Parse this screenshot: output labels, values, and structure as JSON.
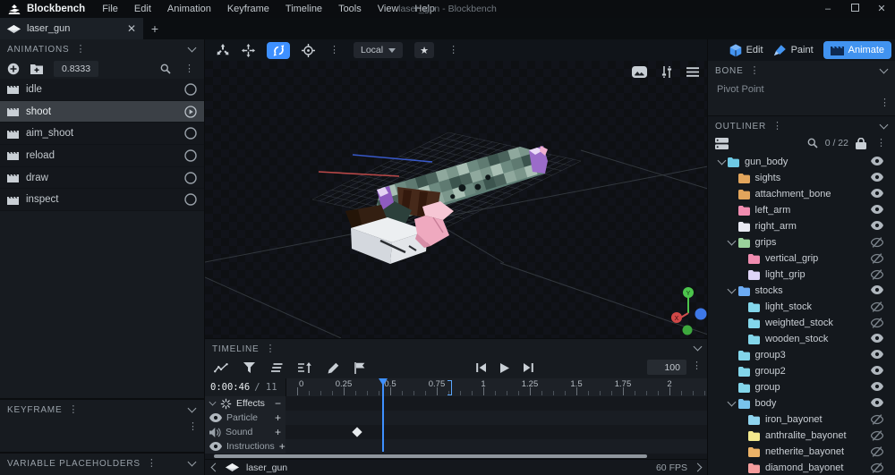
{
  "menubar": {
    "brand": "Blockbench",
    "items": [
      "File",
      "Edit",
      "Animation",
      "Keyframe",
      "Timeline",
      "Tools",
      "View",
      "Help"
    ],
    "window_title": "laser_gun - Blockbench"
  },
  "tab": {
    "title": "laser_gun"
  },
  "tool_toolbar": {
    "space_label": "Local"
  },
  "modes": {
    "edit": "Edit",
    "paint": "Paint",
    "animate": "Animate"
  },
  "animations_panel": {
    "title": "ANIMATIONS",
    "length_value": "0.8333",
    "items": [
      {
        "name": "idle",
        "selected": false
      },
      {
        "name": "shoot",
        "selected": true
      },
      {
        "name": "aim_shoot",
        "selected": false
      },
      {
        "name": "reload",
        "selected": false
      },
      {
        "name": "draw",
        "selected": false
      },
      {
        "name": "inspect",
        "selected": false
      }
    ]
  },
  "keyframe_panel": {
    "title": "KEYFRAME"
  },
  "variable_placeholders_panel": {
    "title": "VARIABLE PLACEHOLDERS"
  },
  "bone_panel": {
    "title": "BONE",
    "field_label": "Pivot Point"
  },
  "outliner": {
    "title": "OUTLINER",
    "search_count": "0 / 22",
    "nodes": [
      {
        "name": "gun_body",
        "depth": 0,
        "expanded": true,
        "visible": true,
        "color": "#6ec9e4"
      },
      {
        "name": "sights",
        "depth": 1,
        "expanded": false,
        "visible": true,
        "color": "#e2a55c"
      },
      {
        "name": "attachment_bone",
        "depth": 1,
        "expanded": false,
        "visible": true,
        "color": "#e2a55c"
      },
      {
        "name": "left_arm",
        "depth": 1,
        "expanded": false,
        "visible": true,
        "color": "#f08cb0"
      },
      {
        "name": "right_arm",
        "depth": 1,
        "expanded": false,
        "visible": true,
        "color": "#e8e9f2"
      },
      {
        "name": "grips",
        "depth": 1,
        "expanded": true,
        "visible": false,
        "color": "#9ad39c"
      },
      {
        "name": "vertical_grip",
        "depth": 2,
        "expanded": false,
        "visible": false,
        "color": "#f08cb0"
      },
      {
        "name": "light_grip",
        "depth": 2,
        "expanded": false,
        "visible": false,
        "color": "#ded4f6"
      },
      {
        "name": "stocks",
        "depth": 1,
        "expanded": true,
        "visible": true,
        "color": "#6cabf2"
      },
      {
        "name": "light_stock",
        "depth": 2,
        "expanded": false,
        "visible": false,
        "color": "#83d6ea"
      },
      {
        "name": "weighted_stock",
        "depth": 2,
        "expanded": false,
        "visible": false,
        "color": "#83d6ea"
      },
      {
        "name": "wooden_stock",
        "depth": 2,
        "expanded": false,
        "visible": true,
        "color": "#83d6ea"
      },
      {
        "name": "group3",
        "depth": 1,
        "expanded": false,
        "visible": true,
        "color": "#83d6ea"
      },
      {
        "name": "group2",
        "depth": 1,
        "expanded": false,
        "visible": true,
        "color": "#83d6ea"
      },
      {
        "name": "group",
        "depth": 1,
        "expanded": false,
        "visible": true,
        "color": "#83d6ea"
      },
      {
        "name": "body",
        "depth": 1,
        "expanded": true,
        "visible": true,
        "color": "#79c3ec"
      },
      {
        "name": "iron_bayonet",
        "depth": 2,
        "expanded": false,
        "visible": false,
        "color": "#8fd4ef"
      },
      {
        "name": "anthralite_bayonet",
        "depth": 2,
        "expanded": false,
        "visible": false,
        "color": "#f3e88e"
      },
      {
        "name": "netherite_bayonet",
        "depth": 2,
        "expanded": false,
        "visible": false,
        "color": "#edb368"
      },
      {
        "name": "diamond_bayonet",
        "depth": 2,
        "expanded": false,
        "visible": false,
        "color": "#f59d9d"
      }
    ]
  },
  "timeline": {
    "title": "TIMELINE",
    "current_time": "0:00:46",
    "total_frames": "/  11",
    "zoom_level": "100",
    "ruler_ticks": [
      "0",
      "0.25",
      "0.5",
      "0.75",
      "1",
      "1.25",
      "1.5",
      "1.75",
      "2"
    ],
    "playhead_time": 0.4666,
    "end_marker_time": 0.8333,
    "keyframes": [
      {
        "track_index": 2,
        "time": 0.325
      }
    ],
    "tracks": [
      {
        "label": "Effects",
        "icon": "effects",
        "action": "remove"
      },
      {
        "label": "Particle",
        "icon": "eye",
        "action": "add"
      },
      {
        "label": "Sound",
        "icon": "sound",
        "action": "add"
      },
      {
        "label": "Instructions",
        "icon": "eye",
        "action": "add"
      }
    ]
  },
  "statusbar": {
    "model_name": "laser_gun",
    "fps": "60 FPS"
  },
  "colors": {
    "accent": "#3e90ff",
    "selection_bg": "#3b4046",
    "playhead": "#3e90ff"
  }
}
